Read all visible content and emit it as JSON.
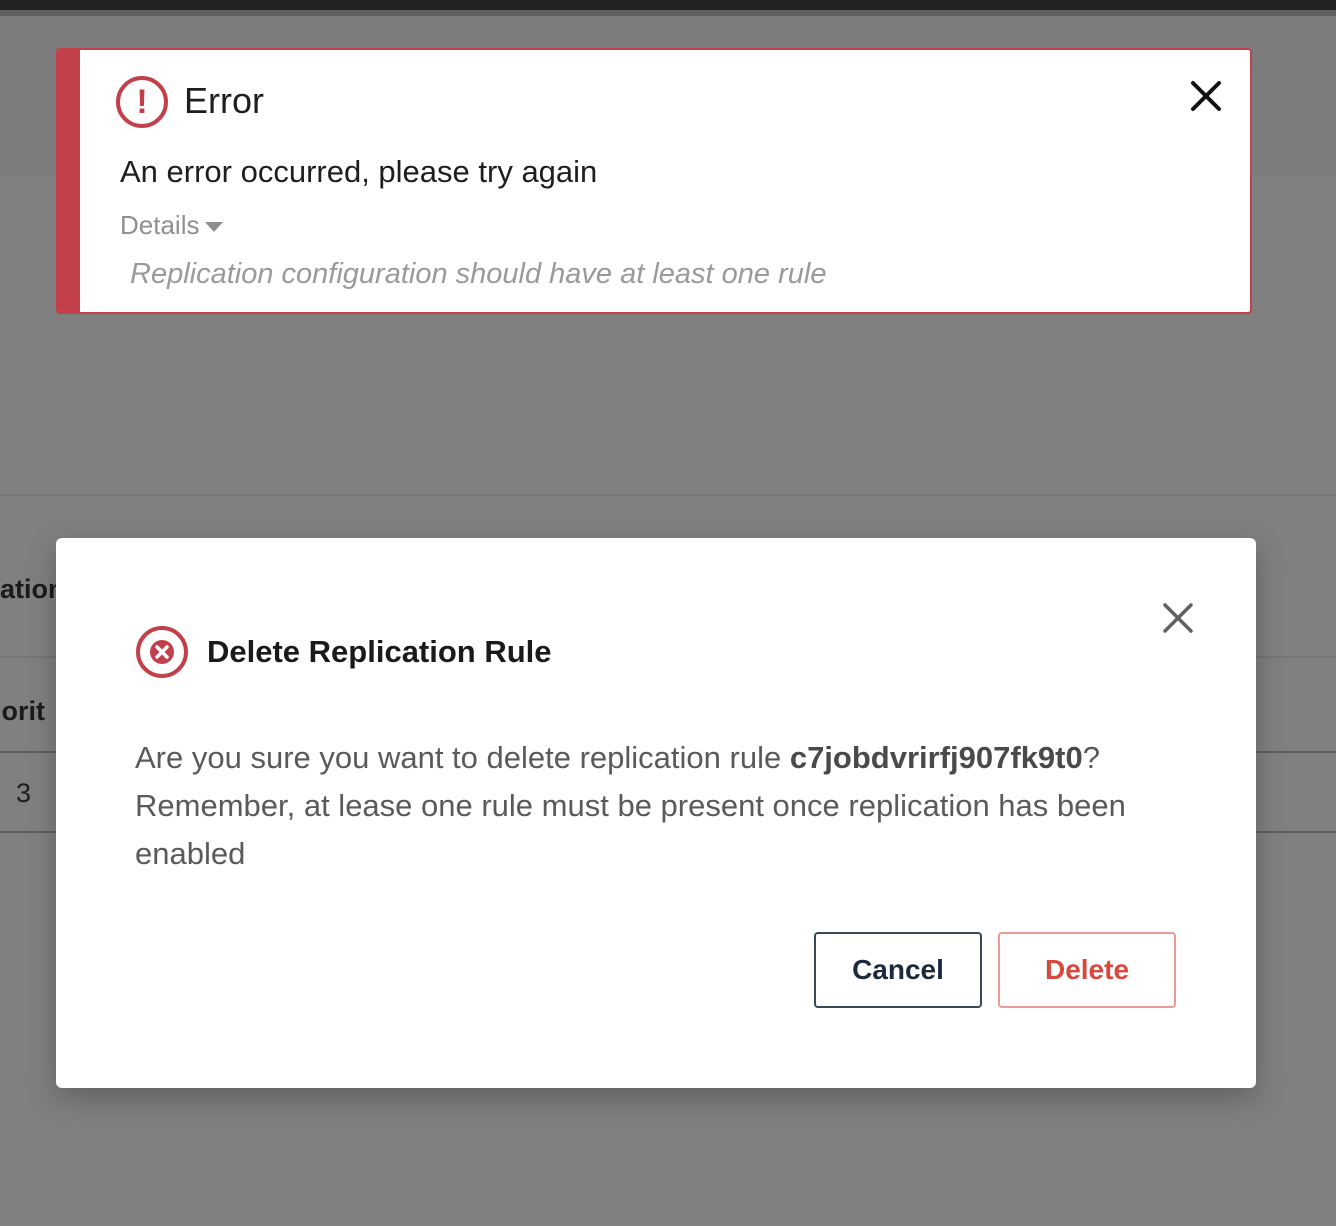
{
  "background": {
    "column_header": "ation",
    "subheader": "iorit",
    "row_value": "3"
  },
  "toast": {
    "title": "Error",
    "message": "An error occurred, please try again",
    "details_label": "Details",
    "detail_text": "Replication configuration should have at least one rule",
    "accent_color": "#c2404a"
  },
  "modal": {
    "title": "Delete Replication Rule",
    "body_prefix": "Are you sure you want to delete replication rule ",
    "rule_id": "c7jobdvrirfj907fk9t0",
    "body_suffix": "?",
    "body_line2": "Remember, at lease one rule must be present once replication has been enabled",
    "cancel_label": "Cancel",
    "delete_label": "Delete",
    "danger_color": "#d9473d"
  },
  "icons": {
    "toast_icon": "exclamation-circle-icon",
    "modal_icon": "x-circle-icon",
    "close_icon": "close-icon"
  }
}
